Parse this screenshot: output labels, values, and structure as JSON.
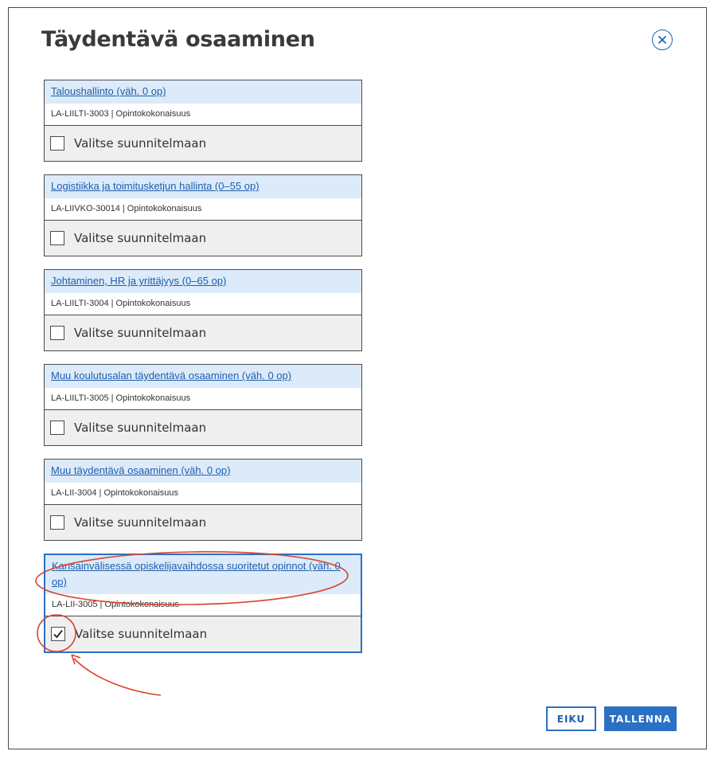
{
  "dialog": {
    "title": "Täydentävä osaaminen",
    "close_icon": "close-icon"
  },
  "modules": [
    {
      "name": "Taloushallinto (väh. 0 op)",
      "code": "LA-LIILTI-3003 | Opintokokonaisuus",
      "select_label": "Valitse suunnitelmaan",
      "checked": false
    },
    {
      "name": "Logistiikka ja toimitusketjun hallinta (0–55 op)",
      "code": "LA-LIIVKO-30014 | Opintokokonaisuus",
      "select_label": "Valitse suunnitelmaan",
      "checked": false
    },
    {
      "name": "Johtaminen, HR ja yrittäjyys (0–65 op)",
      "code": "LA-LIILTI-3004 | Opintokokonaisuus",
      "select_label": "Valitse suunnitelmaan",
      "checked": false
    },
    {
      "name": "Muu koulutusalan täydentävä osaaminen (väh. 0 op)",
      "code": "LA-LIILTI-3005 | Opintokokonaisuus",
      "select_label": "Valitse suunnitelmaan",
      "checked": false
    },
    {
      "name": "Muu täydentävä osaaminen (väh. 0 op)",
      "code": "LA-LII-3004 | Opintokokonaisuus",
      "select_label": "Valitse suunnitelmaan",
      "checked": false
    },
    {
      "name": "Kansainvälisessä opiskelijavaihdossa suoritetut opinnot (väh. 0 op)",
      "code": "LA-LII-3005 | Opintokokonaisuus",
      "select_label": "Valitse suunnitelmaan",
      "checked": true
    }
  ],
  "actions": {
    "cancel_label": "EIKU",
    "save_label": "TALLENNA"
  },
  "colors": {
    "accent": "#2a70c4",
    "link": "#1f5fad",
    "header_bg": "#dceafa",
    "annotation": "#d9442a"
  }
}
